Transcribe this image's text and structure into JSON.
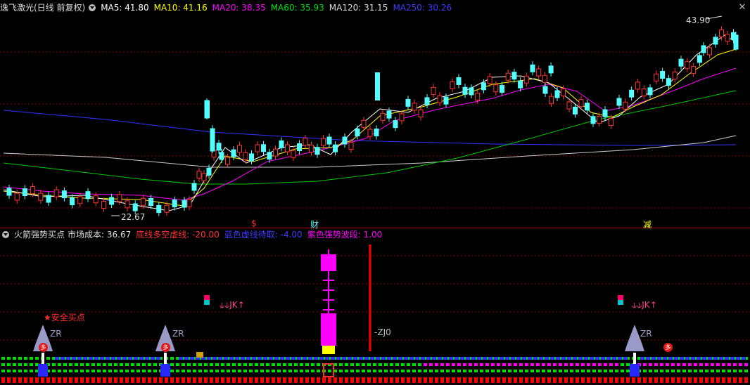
{
  "main_header": {
    "title": "逸飞激光(日线 前复权)",
    "ma5": "MA5: 41.80",
    "ma10": "MA10: 41.16",
    "ma20": "MA20: 38.35",
    "ma60": "MA60: 35.93",
    "ma120": "MA120: 31.15",
    "ma250": "MA250: 30.26"
  },
  "indicator_header": {
    "title": "火箭强势买点",
    "cost": "市场成本: 36.67",
    "bottom_line": "底线多空虚线: -20.00",
    "blue_line": "蓝色虚线待取: -4.00",
    "purple_line": "紫色强势波段: 1.00"
  },
  "colors": {
    "up": "#ff3232",
    "down": "#54ffff",
    "ma5": "#ffffff",
    "ma10": "#ffff00",
    "ma20": "#ff00ff",
    "ma60": "#00c800",
    "ma120": "#cccccc",
    "ma250": "#3232ff",
    "grid": "#8b0000",
    "separator": "#c00000"
  },
  "price_labels": {
    "high": "43.90",
    "low": "22.67"
  },
  "event_markers": {
    "m1": "$",
    "m2": "财",
    "m3": "减"
  },
  "signals": {
    "safe_buy": "安全买点",
    "zr": "ZR",
    "duo": "多",
    "jk": "JK",
    "zj0": "ZJ0"
  },
  "icons": [
    "menu-dot-icon",
    "close-icon",
    "star-icon",
    "rocket-icon"
  ],
  "chart_data": {
    "type": "candlestick",
    "ma_lines": [
      "MA5",
      "MA10",
      "MA20",
      "MA60",
      "MA120",
      "MA250"
    ],
    "price_high": 43.9,
    "price_low": 22.67
  }
}
